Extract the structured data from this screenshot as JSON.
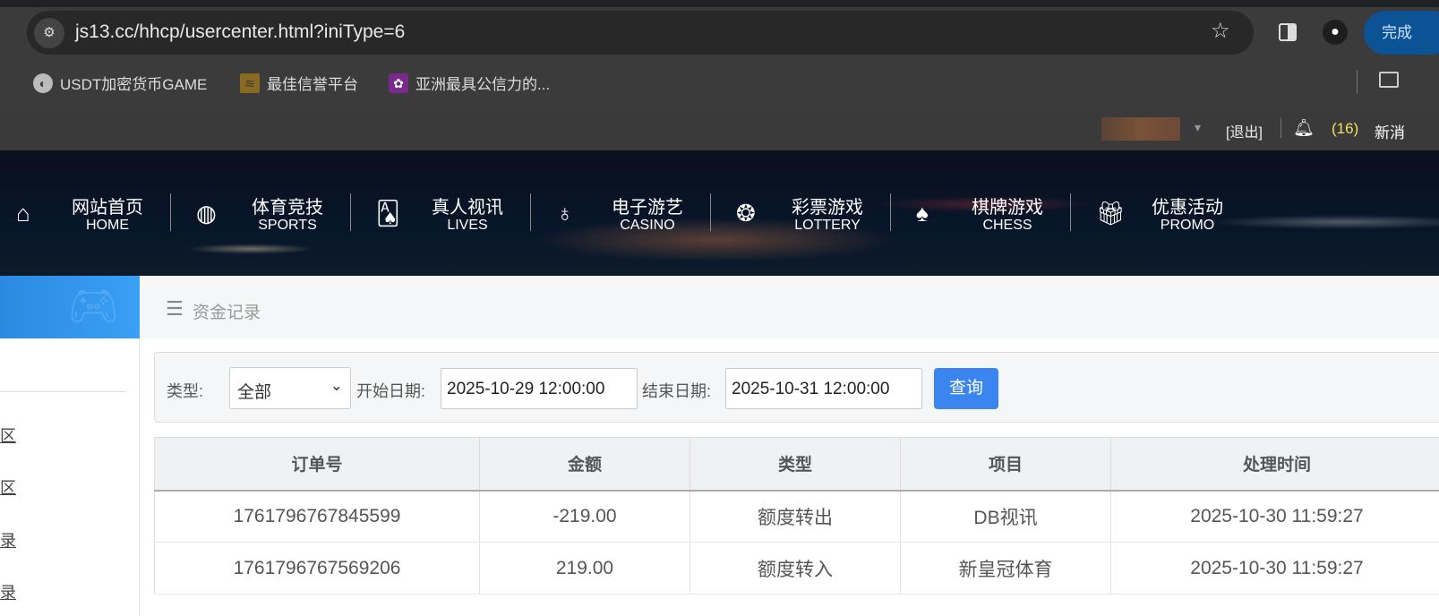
{
  "browser": {
    "url": "js13.cc/hhcp/usercenter.html?iniType=6",
    "profile_button": "完成",
    "bookmarks": [
      {
        "label": "USDT加密货币GAME",
        "icon": "globe-icon"
      },
      {
        "label": "最佳信誉平台",
        "icon": "site-logo-icon"
      },
      {
        "label": "亚洲最具公信力的...",
        "icon": "flower-logo-icon"
      }
    ]
  },
  "topbar": {
    "logout": "[退出]",
    "message_count": "(16)",
    "message_label": "新消",
    "message_color": "#f0e060"
  },
  "nav": [
    {
      "zh": "网站首页",
      "en": "HOME",
      "icon": "home-icon"
    },
    {
      "zh": "体育竞技",
      "en": "SPORTS",
      "icon": "ball-icon"
    },
    {
      "zh": "真人视讯",
      "en": "LIVES",
      "icon": "cards-icon"
    },
    {
      "zh": "电子游艺",
      "en": "CASINO",
      "icon": "roulette-icon"
    },
    {
      "zh": "彩票游戏",
      "en": "LOTTERY",
      "icon": "lottery-balls-icon"
    },
    {
      "zh": "棋牌游戏",
      "en": "CHESS",
      "icon": "spade-icon"
    },
    {
      "zh": "优惠活动",
      "en": "PROMO",
      "icon": "gift-icon"
    }
  ],
  "sidebar": {
    "items": [
      "区",
      "区",
      "录",
      "录"
    ]
  },
  "breadcrumb": "资金记录",
  "filter": {
    "type_label": "类型:",
    "type_value": "全部",
    "start_label": "开始日期:",
    "start_value": "2025-10-29 12:00:00",
    "end_label": "结束日期:",
    "end_value": "2025-10-31 12:00:00",
    "query_button": "查询",
    "accent": "#3a85ef"
  },
  "table": {
    "headers": [
      "订单号",
      "金额",
      "类型",
      "项目",
      "处理时间"
    ],
    "rows": [
      [
        "1761796767845599",
        "-219.00",
        "额度转出",
        "DB视讯",
        "2025-10-30 11:59:27"
      ],
      [
        "1761796767569206",
        "219.00",
        "额度转入",
        "新皇冠体育",
        "2025-10-30 11:59:27"
      ]
    ]
  }
}
